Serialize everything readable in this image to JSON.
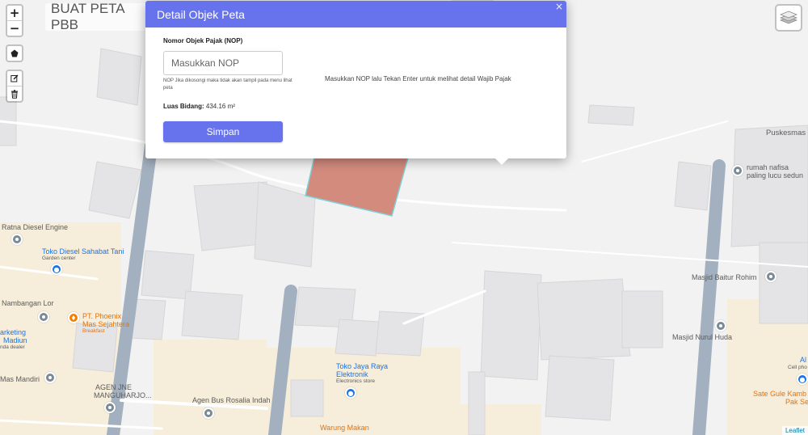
{
  "app": {
    "map_title": "BUAT PETA PBB",
    "attribution": "Leaflet"
  },
  "controls": {
    "zoom_in": "+",
    "zoom_out": "−",
    "draw_polygon_icon": "pentagon-icon",
    "edit_icon": "edit-icon",
    "delete_icon": "trash-icon",
    "layers_icon": "layers-icon"
  },
  "popup": {
    "title": "Detail Objek Peta",
    "close": "×",
    "nop_label": "Nomor Objek Pajak (NOP)",
    "nop_placeholder": "Masukkan NOP",
    "nop_value": "",
    "help_text": "NOP Jika dikosongi maka tidak akan tampil pada menu lihat peta",
    "luas_label": "Luas Bidang:",
    "luas_value": "434.16 m²",
    "save_label": "Simpan",
    "info_message": "Masukkan NOP lalu Tekan Enter untuk melihat detail Wajib Pajak"
  },
  "map_labels": {
    "puskesmas": "Puskesmas",
    "rumah_nafisa_1": "rumah nafisa",
    "rumah_nafisa_2": "paling lucu sedun",
    "ratna": "Ratna Diesel Engine",
    "toko_diesel": "Toko Diesel Sahabat Tani",
    "toko_diesel_sub": "Garden center",
    "nambangan": "Nambangan Lor",
    "phoenix_1": "PT. Phoenix",
    "phoenix_2": "Mas Sejahtera",
    "phoenix_sub": "Breakfast",
    "marketing_1": "arketing",
    "marketing_2": "Madiun",
    "marketing_sub": "nda dealer",
    "mas_mandiri": "Mas Mandiri",
    "agen_jne_1": "AGEN JNE",
    "agen_jne_2": "MANGUHARJO...",
    "agen_bus": "Agen Bus Rosalia Indah",
    "toko_jaya_1": "Toko Jaya Raya",
    "toko_jaya_2": "Elektronik",
    "toko_jaya_sub": "Electronics store",
    "warung": "Warung Makan",
    "masjid_baitur": "Masjid Baitur Rohim",
    "masjid_nurul": "Masjid Nurul Huda",
    "al": "Al",
    "cell_sub": "Cell pho",
    "sate_1": "Sate Gule Kamb",
    "sate_2": "Pak Ser"
  },
  "colors": {
    "accent": "#6673ec",
    "polygon_fill": "#d38b7e",
    "polygon_stroke": "#7fd3d8",
    "road": "#a3b0bf"
  }
}
